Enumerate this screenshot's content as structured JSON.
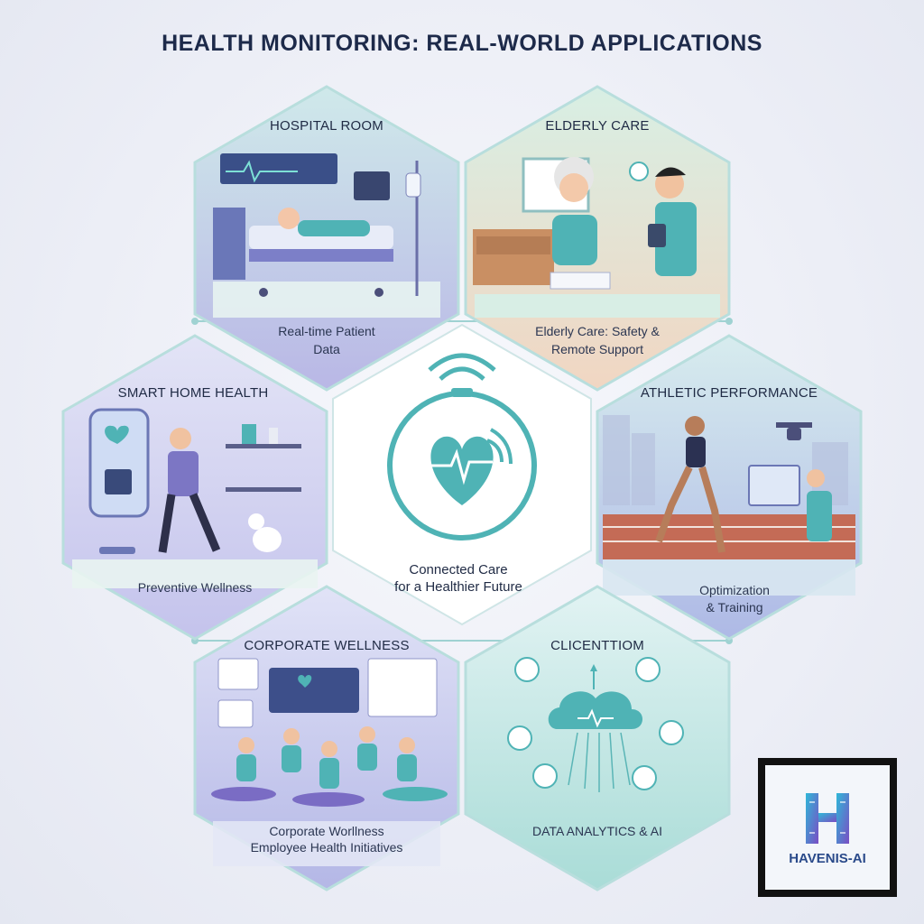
{
  "title": "HEALTH MONITORING: REAL-WORLD APPLICATIONS",
  "center": {
    "line1": "Connected Care",
    "line2": "for a Healthier Future"
  },
  "hexes": {
    "hospital": {
      "heading": "HOSPITAL ROOM",
      "caption1": "Real-time Patient",
      "caption2": "Data"
    },
    "elderly": {
      "heading": "ELDERLY CARE",
      "caption1": "Elderly Care: Safety &",
      "caption2": "Remote Support"
    },
    "smart_home": {
      "heading": "SMART HOME HEALTH",
      "caption1": "Preventive Wellness"
    },
    "athletic": {
      "heading": "ATHLETIC PERFORMANCE",
      "caption1": "Optimization",
      "caption2": "& Training"
    },
    "corporate": {
      "heading": "CORPORATE WELLNESS",
      "caption1": "Corporate Worllness",
      "caption2": "Employee Health Initiatives"
    },
    "cloud": {
      "heading": "CLICENTTIOM",
      "caption1": "DATA ANALYTICS & AI"
    }
  },
  "logo": {
    "text": "HAVENIS-AI",
    "letter": "H"
  },
  "colors": {
    "teal": "#4fb3b5",
    "lavender": "#a9a6dc",
    "mint": "#bfe3dc",
    "navy": "#1d2a4a"
  }
}
